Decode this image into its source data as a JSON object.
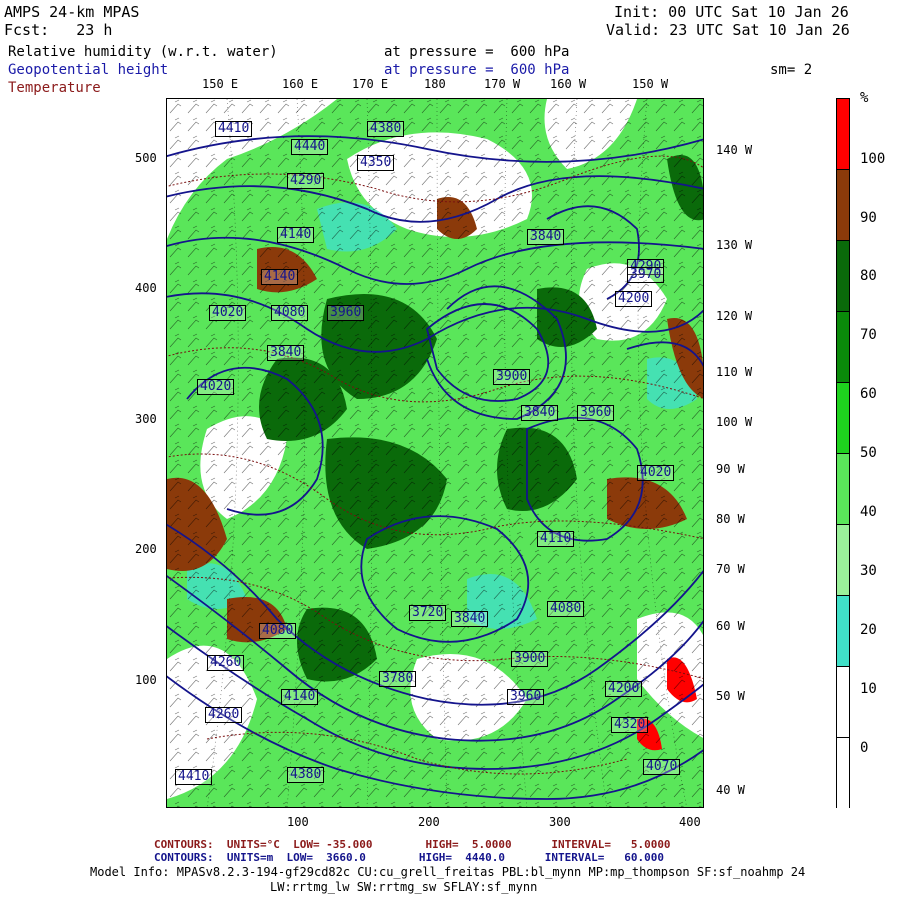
{
  "header": {
    "model": "AMPS 24-km MPAS",
    "forecast": "Fcst:   23 h",
    "init": "Init: 00 UTC Sat 10 Jan 26",
    "valid": "Valid: 23 UTC Sat 10 Jan 26",
    "fields": [
      {
        "name": "Relative humidity (w.r.t. water)",
        "level": "at pressure =  600 hPa",
        "color": "#000000"
      },
      {
        "name": "Geopotential height",
        "level": "at pressure =  600 hPa",
        "color": "#1a1aa8"
      },
      {
        "name": "Temperature",
        "level": "at pressure =  600 hPa",
        "color": "#8b1a1a"
      }
    ],
    "smoothing": "sm= 2"
  },
  "map": {
    "top_lon_labels": [
      "150 E",
      "160 E",
      "170 E",
      "180",
      "170 W",
      "160 W",
      "150 W"
    ],
    "right_lon_labels": [
      "140 W",
      "130 W",
      "120 W",
      "110 W",
      "100 W",
      "90 W",
      "80 W",
      "70 W",
      "60 W",
      "50 W",
      "40 W"
    ],
    "x_ticks": [
      "100",
      "200",
      "300",
      "400"
    ],
    "y_ticks": [
      "500",
      "400",
      "300",
      "200",
      "100"
    ],
    "height_labels": [
      "4410",
      "4380",
      "4440",
      "4350",
      "4290",
      "4140",
      "4140",
      "4020",
      "4080",
      "3840",
      "3960",
      "4200",
      "4290",
      "4260",
      "4080",
      "4020",
      "3900",
      "3840",
      "3960",
      "3780",
      "3720",
      "3840",
      "3900",
      "3960",
      "4080",
      "4140",
      "4260",
      "4380",
      "4410",
      "4200",
      "4320",
      "4020",
      "4110",
      "3970",
      "3840",
      "4070"
    ],
    "colors": {
      "contour_height": "#14148c",
      "contour_temp": "#7a1010",
      "wind_barbs": "#000000"
    }
  },
  "legend": {
    "unit": "%",
    "levels": [
      "100",
      "90",
      "80",
      "70",
      "60",
      "50",
      "40",
      "30",
      "20",
      "10",
      "0"
    ],
    "colors": [
      "#ff0000",
      "#8b3a0a",
      "#0a6a0a",
      "#0a8a0a",
      "#1ed21e",
      "#5ae65a",
      "#9af09a",
      "#40e0c8",
      "#ffffff",
      "#ffffff",
      "#ffffff"
    ]
  },
  "footer": {
    "temp_contours": "CONTOURS:  UNITS=°C  LOW= -35.000        HIGH=  5.0000      INTERVAL=   5.0000",
    "height_contours": "CONTOURS:  UNITS=m  LOW=  3660.0        HIGH=  4440.0      INTERVAL=   60.000",
    "model_info_1": "Model Info: MPASv8.2.3-194-gf29cd82c CU:cu_grell_freitas PBL:bl_mynn MP:mp_thompson SF:sf_noahmp 24",
    "model_info_2": "LW:rrtmg_lw SW:rrtmg_sw SFLAY:sf_mynn"
  }
}
